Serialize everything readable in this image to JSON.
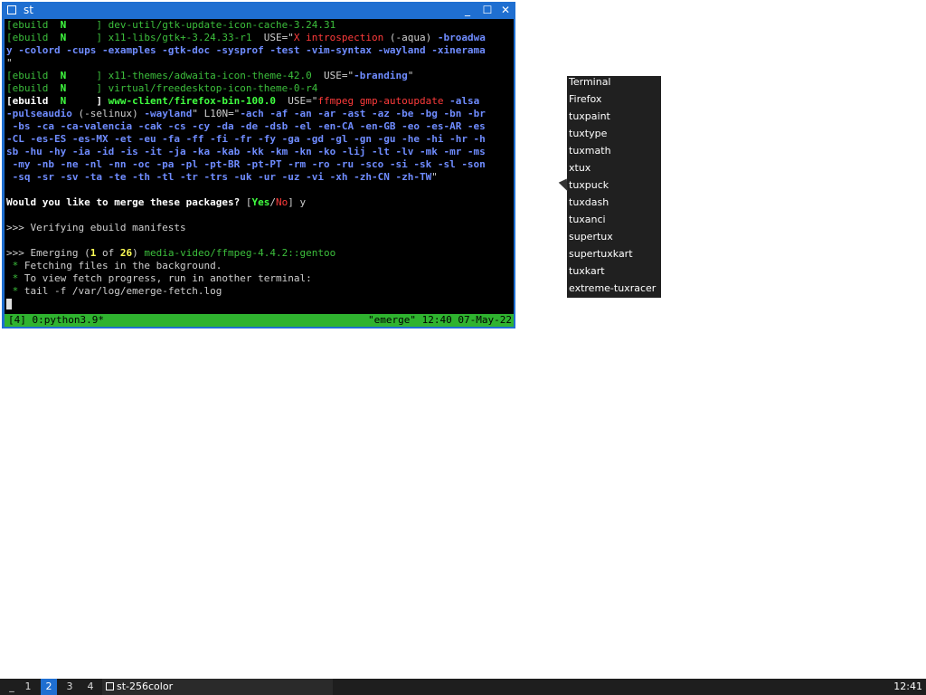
{
  "window": {
    "title": "st",
    "min_label": "_",
    "max_label": "☐",
    "close_label": "✕"
  },
  "terminal": {
    "lines": [
      [
        {
          "t": "[ebuild  ",
          "c": "g"
        },
        {
          "t": "N",
          "c": "gb"
        },
        {
          "t": "     ] ",
          "c": "g"
        },
        {
          "t": "dev-util/gtk-update-icon-cache-3.24.31",
          "c": "g"
        }
      ],
      [
        {
          "t": "[ebuild  ",
          "c": "g"
        },
        {
          "t": "N",
          "c": "gb"
        },
        {
          "t": "     ] ",
          "c": "g"
        },
        {
          "t": "x11-libs/gtk+-3.24.33-r1",
          "c": "g"
        },
        {
          "t": "  USE=\"",
          "c": ""
        },
        {
          "t": "X introspection",
          "c": "r"
        },
        {
          "t": " (-aqua) ",
          "c": ""
        },
        {
          "t": "-broadwa",
          "c": "b"
        }
      ],
      [
        {
          "t": "y -colord -cups -examples -gtk-doc -sysprof -test -vim-syntax -wayland -xinerama",
          "c": "b"
        }
      ],
      [
        {
          "t": "\"",
          "c": ""
        }
      ],
      [
        {
          "t": "[ebuild  ",
          "c": "g"
        },
        {
          "t": "N",
          "c": "gb"
        },
        {
          "t": "     ] ",
          "c": "g"
        },
        {
          "t": "x11-themes/adwaita-icon-theme-42.0",
          "c": "g"
        },
        {
          "t": "  USE=\"",
          "c": ""
        },
        {
          "t": "-branding",
          "c": "b"
        },
        {
          "t": "\"",
          "c": ""
        }
      ],
      [
        {
          "t": "[ebuild  ",
          "c": "g"
        },
        {
          "t": "N",
          "c": "gb"
        },
        {
          "t": "     ] ",
          "c": "g"
        },
        {
          "t": "virtual/freedesktop-icon-theme-0-r4",
          "c": "g"
        }
      ],
      [
        {
          "t": "[ebuild  ",
          "c": "w"
        },
        {
          "t": "N",
          "c": "gb"
        },
        {
          "t": "     ] ",
          "c": "w"
        },
        {
          "t": "www-client/firefox-bin-100.0",
          "c": "gb"
        },
        {
          "t": "  USE=\"",
          "c": ""
        },
        {
          "t": "ffmpeg gmp-autoupdate",
          "c": "r"
        },
        {
          "t": " -alsa",
          "c": "b"
        }
      ],
      [
        {
          "t": "-pulseaudio",
          "c": "b"
        },
        {
          "t": " (-selinux) ",
          "c": ""
        },
        {
          "t": "-wayland",
          "c": "b"
        },
        {
          "t": "\" L10N=\"",
          "c": ""
        },
        {
          "t": "-ach -af -an -ar -ast -az -be -bg -bn -br",
          "c": "b"
        }
      ],
      [
        {
          "t": " -bs -ca -ca-valencia -cak -cs -cy -da -de -dsb -el -en-CA -en-GB -eo -es-AR -es",
          "c": "b"
        }
      ],
      [
        {
          "t": "-CL -es-ES -es-MX -et -eu -fa -ff -fi -fr -fy -ga -gd -gl -gn -gu -he -hi -hr -h",
          "c": "b"
        }
      ],
      [
        {
          "t": "sb -hu -hy -ia -id -is -it -ja -ka -kab -kk -km -kn -ko -lij -lt -lv -mk -mr -ms",
          "c": "b"
        }
      ],
      [
        {
          "t": " -my -nb -ne -nl -nn -oc -pa -pl -pt-BR -pt-PT -rm -ro -ru -sco -si -sk -sl -son",
          "c": "b"
        }
      ],
      [
        {
          "t": " -sq -sr -sv -ta -te -th -tl -tr -trs -uk -ur -uz -vi -xh -zh-CN -zh-TW",
          "c": "b"
        },
        {
          "t": "\"",
          "c": ""
        }
      ],
      [
        {
          "t": "",
          "c": ""
        }
      ],
      [
        {
          "t": "Would you like to merge these packages? ",
          "c": "w"
        },
        {
          "t": "[",
          "c": ""
        },
        {
          "t": "Yes",
          "c": "gb"
        },
        {
          "t": "/",
          "c": ""
        },
        {
          "t": "No",
          "c": "r"
        },
        {
          "t": "] y",
          "c": ""
        }
      ],
      [
        {
          "t": "",
          "c": ""
        }
      ],
      [
        {
          "t": ">>> Verifying ebuild manifests",
          "c": ""
        }
      ],
      [
        {
          "t": "",
          "c": ""
        }
      ],
      [
        {
          "t": ">>> Emerging (",
          "c": ""
        },
        {
          "t": "1",
          "c": "y"
        },
        {
          "t": " of ",
          "c": ""
        },
        {
          "t": "26",
          "c": "y"
        },
        {
          "t": ") ",
          "c": ""
        },
        {
          "t": "media-video/ffmpeg-4.4.2::gentoo",
          "c": "g"
        }
      ],
      [
        {
          "t": " * ",
          "c": "g"
        },
        {
          "t": "Fetching files in the background.",
          "c": ""
        }
      ],
      [
        {
          "t": " * ",
          "c": "g"
        },
        {
          "t": "To view fetch progress, run in another terminal:",
          "c": ""
        }
      ],
      [
        {
          "t": " * ",
          "c": "g"
        },
        {
          "t": "tail -f /var/log/emerge-fetch.log",
          "c": ""
        }
      ]
    ],
    "status_left": "[4] 0:python3.9*",
    "status_right": "\"emerge\" 12:40 07-May-22"
  },
  "menu": {
    "items": [
      "Terminal",
      "Firefox",
      "tuxpaint",
      "tuxtype",
      "tuxmath",
      "xtux",
      "tuxpuck",
      "tuxdash",
      "tuxanci",
      "supertux",
      "supertuxkart",
      "tuxkart",
      "extreme-tuxracer"
    ]
  },
  "taskbar": {
    "workspaces": [
      "_",
      "1",
      "2",
      "3",
      "4"
    ],
    "active_workspace": "2",
    "task_label": "st-256color",
    "clock": "12:41"
  },
  "colors": {
    "accent": "#1f6fd1",
    "status_bar": "#2fb32f",
    "terminal_bg": "#000000"
  }
}
